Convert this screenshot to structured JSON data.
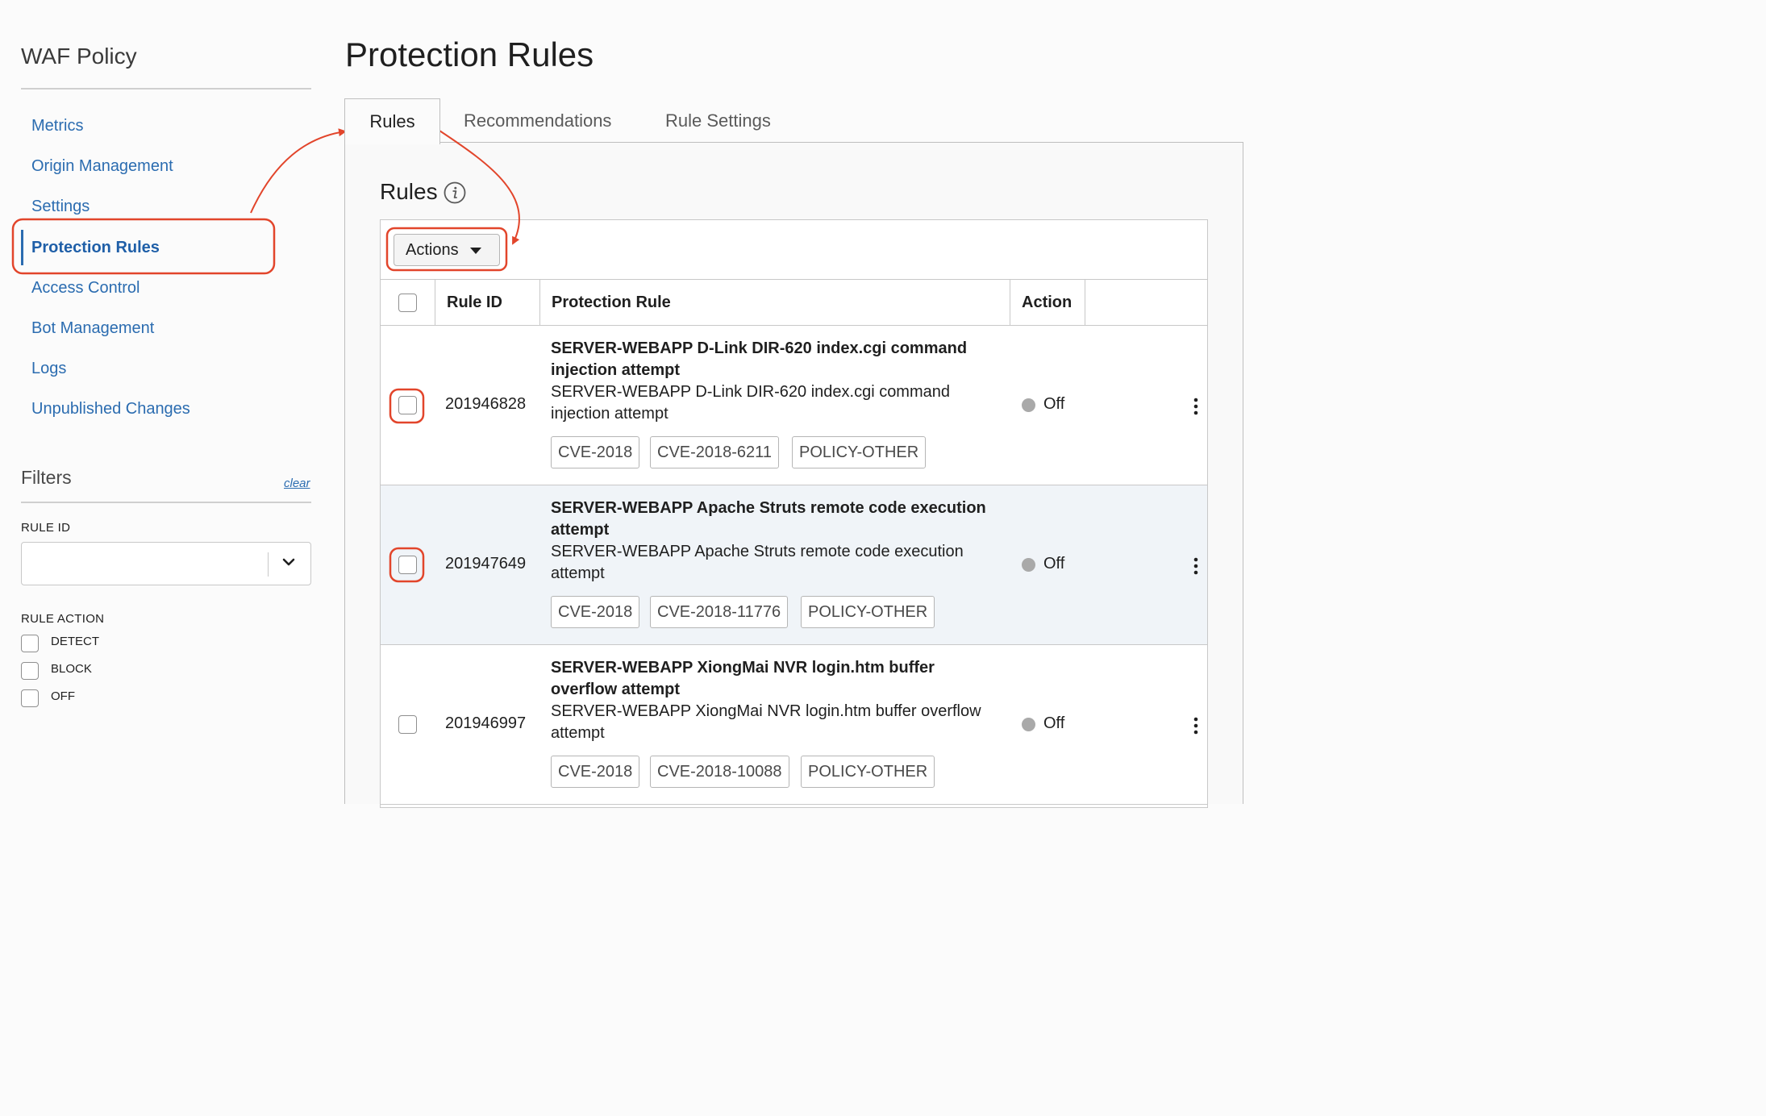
{
  "sidebar": {
    "title": "WAF Policy",
    "nav": [
      {
        "label": "Metrics"
      },
      {
        "label": "Origin Management"
      },
      {
        "label": "Settings"
      },
      {
        "label": "Protection Rules",
        "active": true
      },
      {
        "label": "Access Control"
      },
      {
        "label": "Bot Management"
      },
      {
        "label": "Logs"
      },
      {
        "label": "Unpublished Changes"
      }
    ],
    "filters": {
      "title": "Filters",
      "clear_label": "clear",
      "rule_id_label": "RULE ID",
      "rule_id_value": "",
      "rule_action_label": "RULE ACTION",
      "rule_action_options": [
        "DETECT",
        "BLOCK",
        "OFF"
      ]
    }
  },
  "page": {
    "title": "Protection Rules"
  },
  "tabs": [
    {
      "label": "Rules",
      "active": true
    },
    {
      "label": "Recommendations"
    },
    {
      "label": "Rule Settings"
    }
  ],
  "rules_section": {
    "title": "Rules",
    "actions_label": "Actions",
    "columns": [
      "Rule ID",
      "Protection Rule",
      "Action"
    ],
    "rows": [
      {
        "rule_id": "201946828",
        "title": "SERVER-WEBAPP D-Link DIR-620 index.cgi command injection attempt",
        "description": "SERVER-WEBAPP D-Link DIR-620 index.cgi command injection attempt",
        "tags": [
          "CVE-2018",
          "CVE-2018-6211",
          "POLICY-OTHER"
        ],
        "action": "Off"
      },
      {
        "rule_id": "201947649",
        "title": "SERVER-WEBAPP Apache Struts remote code execution attempt",
        "description": "SERVER-WEBAPP Apache Struts remote code execution attempt",
        "tags": [
          "CVE-2018",
          "CVE-2018-11776",
          "POLICY-OTHER"
        ],
        "action": "Off"
      },
      {
        "rule_id": "201946997",
        "title": "SERVER-WEBAPP XiongMai NVR login.htm buffer overflow attempt",
        "description": "SERVER-WEBAPP XiongMai NVR login.htm buffer overflow attempt",
        "tags": [
          "CVE-2018",
          "CVE-2018-10088",
          "POLICY-OTHER"
        ],
        "action": "Off"
      }
    ]
  },
  "colors": {
    "link": "#2b6cb0",
    "annotation": "#e2452b",
    "status_off": "#a9a9a9",
    "row_alt": "#f0f4f8"
  },
  "icons": [
    "info-icon",
    "chevron-down-icon",
    "caret-down-icon",
    "kebab-menu-icon"
  ]
}
